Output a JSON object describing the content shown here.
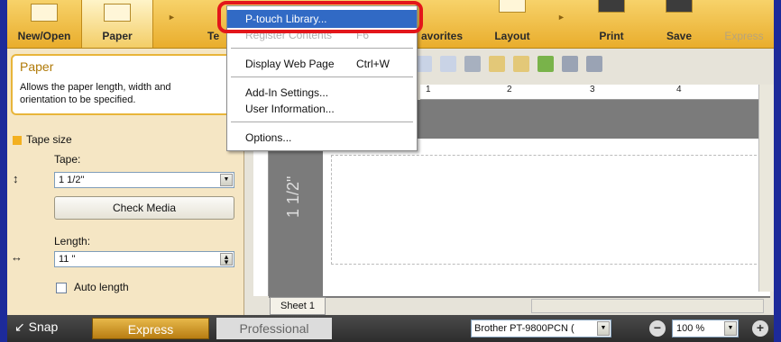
{
  "toolbar": {
    "buttons": [
      {
        "label": "New/Open"
      },
      {
        "label": "Paper"
      },
      {
        "label": "Te"
      },
      {
        "label": "avorites"
      },
      {
        "label": "Layout"
      },
      {
        "label": "Print"
      },
      {
        "label": "Save"
      },
      {
        "label": "Express"
      }
    ]
  },
  "menu": {
    "items": [
      {
        "label": "P-touch Library...",
        "shortcut": ""
      },
      {
        "label": "Register Contents",
        "shortcut": "F6"
      },
      {
        "label": "Display Web Page",
        "shortcut": "Ctrl+W"
      },
      {
        "label": "Add-In Settings...",
        "shortcut": ""
      },
      {
        "label": "User Information...",
        "shortcut": ""
      },
      {
        "label": "Options...",
        "shortcut": ""
      }
    ]
  },
  "panel": {
    "title": "Paper",
    "description": "Allows the paper length, width and orientation to be specified.",
    "section": "Tape size",
    "tape_label": "Tape:",
    "tape_value": "1 1/2\"",
    "check_media": "Check Media",
    "length_label": "Length:",
    "length_value": "11 \"",
    "auto_length": "Auto length"
  },
  "canvas": {
    "tape_width_label": "1 1/2\"",
    "sheet_tab": "Sheet 1",
    "ruler_numbers": [
      "1",
      "2",
      "3",
      "4"
    ]
  },
  "status": {
    "snap": "Snap",
    "express": "Express",
    "professional": "Professional",
    "printer": "Brother PT-9800PCN (",
    "zoom": "100 %"
  },
  "colors": {
    "toolbar": "#e9ad2c",
    "highlight": "#316ac5",
    "callout": "#e3161a"
  }
}
